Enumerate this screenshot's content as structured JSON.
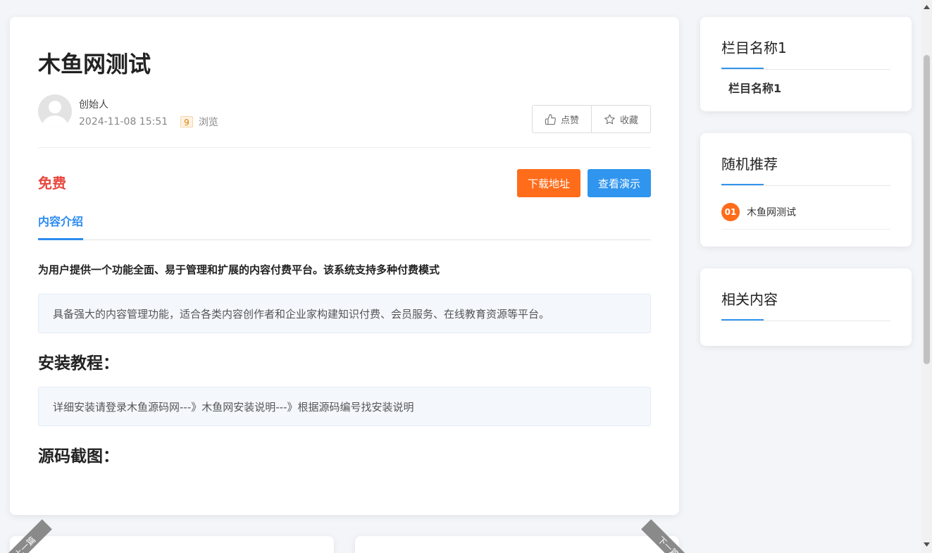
{
  "article": {
    "title": "木鱼网测试",
    "author": "创始人",
    "date": "2024-11-08 15:51",
    "views": "9",
    "views_label": "浏览",
    "like_label": "点赞",
    "favorite_label": "收藏",
    "price": "免费",
    "download_label": "下载地址",
    "demo_label": "查看演示",
    "tab_label": "内容介绍",
    "lead": "为用户提供一个功能全面、易于管理和扩展的内容付费平台。该系统支持多种付费模式",
    "quote1": "具备强大的内容管理功能，适合各类内容创作者和企业家构建知识付费、会员服务、在线教育资源等平台。",
    "heading_install": "安装教程：",
    "quote2": "详细安装请登录木鱼源码网---》木鱼网安装说明---》根据源码编号找安装说明",
    "heading_screenshots": "源码截图："
  },
  "sidebar": {
    "category": {
      "title": "栏目名称1",
      "item": "栏目名称1"
    },
    "random": {
      "title": "随机推荐",
      "items": [
        {
          "rank": "01",
          "title": "木鱼网测试"
        }
      ]
    },
    "related": {
      "title": "相关内容"
    }
  },
  "nav": {
    "prev_label": "上一篇",
    "next_label": "下一篇"
  },
  "colors": {
    "accent_blue": "#3095ee",
    "accent_orange": "#ff6c1a",
    "price_red": "#e8473d"
  }
}
